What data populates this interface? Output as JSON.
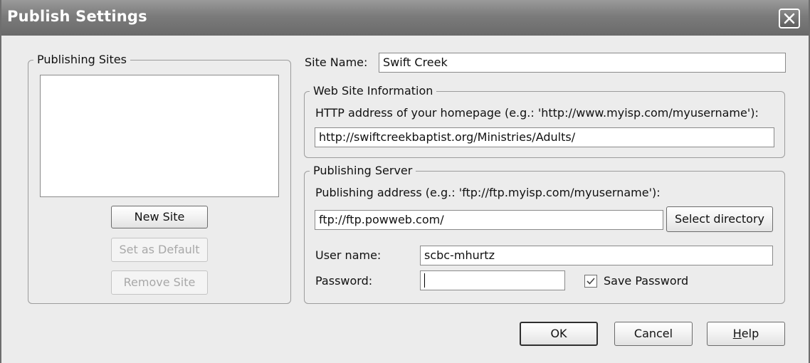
{
  "window": {
    "title": "Publish Settings"
  },
  "publishing_sites": {
    "legend": "Publishing Sites",
    "items": [],
    "new_site_label": "New Site",
    "set_default_label": "Set as Default",
    "remove_site_label": "Remove Site"
  },
  "site_name": {
    "label": "Site Name:",
    "value": "Swift Creek"
  },
  "web_site_info": {
    "legend": "Web Site Information",
    "http_label": "HTTP address of your homepage (e.g.: 'http://www.myisp.com/myusername'):",
    "http_value": "http://swiftcreekbaptist.org/Ministries/Adults/"
  },
  "publishing_server": {
    "legend": "Publishing Server",
    "address_label": "Publishing address (e.g.: 'ftp://ftp.myisp.com/myusername'):",
    "address_value": "ftp://ftp.powweb.com/",
    "select_directory_label": "Select directory",
    "username_label": "User name:",
    "username_value": "scbc-mhurtz",
    "password_label": "Password:",
    "password_value": "",
    "save_password_label": "Save Password",
    "save_password_checked": true
  },
  "footer": {
    "ok_label": "OK",
    "cancel_label": "Cancel",
    "help_label_rest": "elp",
    "help_label_mnemonic": "H"
  },
  "icons": {
    "close": "close-icon",
    "check": "checkmark-icon"
  },
  "colors": {
    "titlebar": "#7b7b7b",
    "dialog_bg": "#ececec"
  }
}
